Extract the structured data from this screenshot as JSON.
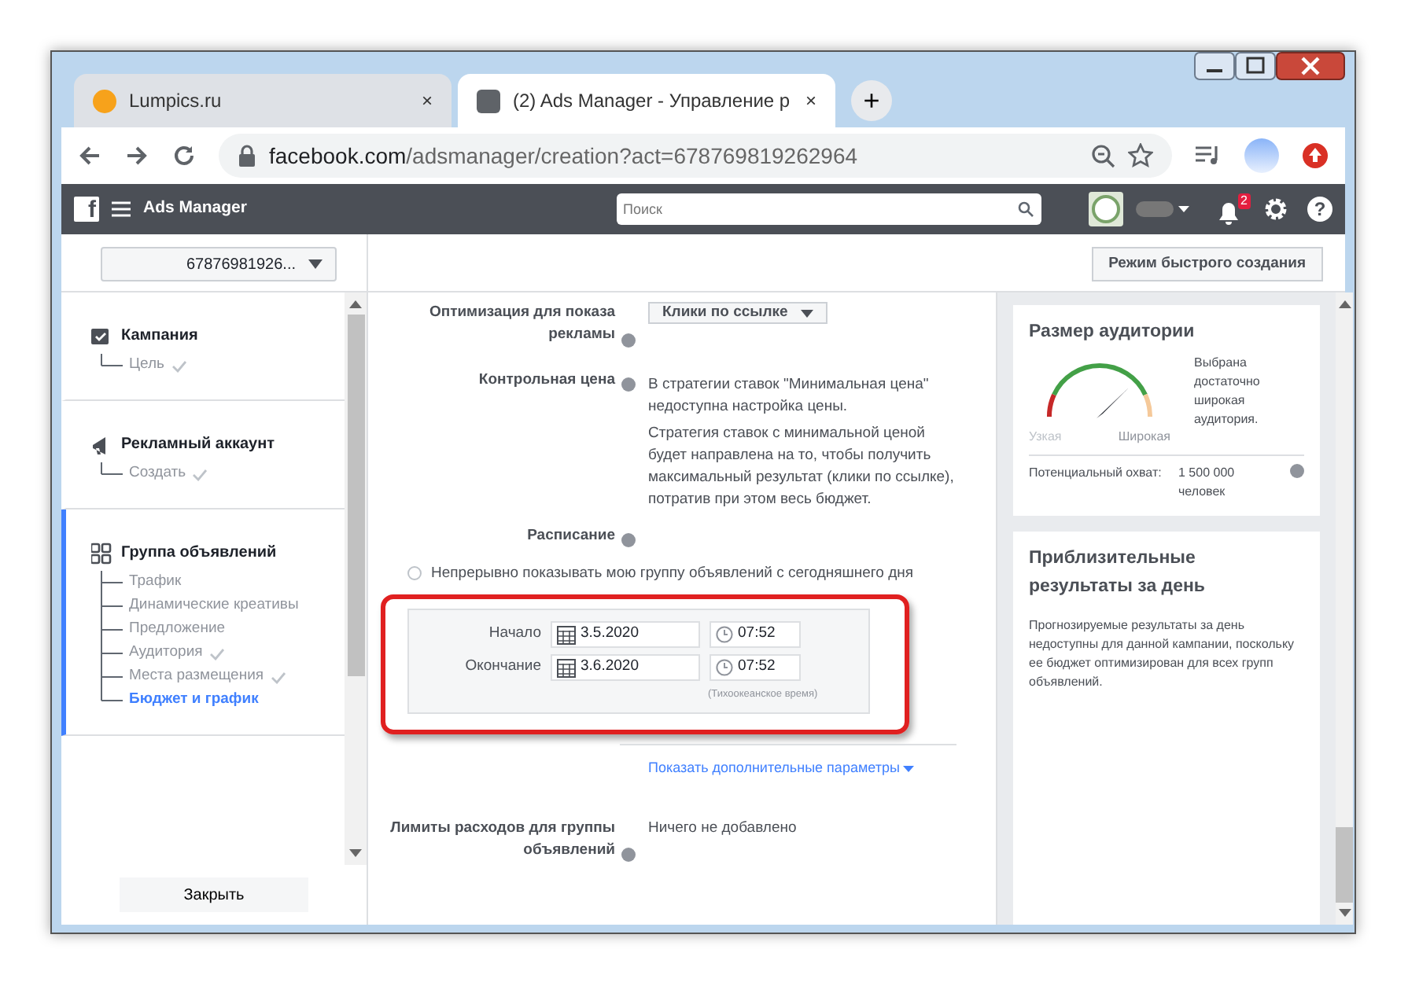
{
  "browser": {
    "tabs": [
      {
        "title": "Lumpics.ru",
        "close": "×",
        "selected": false,
        "color": "#f7a21b"
      },
      {
        "title": "(2) Ads Manager - Управление р",
        "close": "×",
        "selected": true,
        "color": "#5f6368"
      }
    ],
    "new_tab": "+",
    "url_host": "facebook.com",
    "url_path": "/adsmanager/creation?act=678769819262964"
  },
  "header": {
    "logo": "f",
    "title": "Ads Manager",
    "search_placeholder": "Поиск",
    "notifications": "2",
    "help": "?"
  },
  "account_selector": "67876981926...",
  "quick_mode_button": "Режим быстрого создания",
  "sidebar": {
    "sections": [
      {
        "kind": "campaign",
        "title": "Кампания",
        "active": false,
        "children": [
          {
            "label": "Цель",
            "done": true,
            "selected": false
          }
        ]
      },
      {
        "kind": "account",
        "title": "Рекламный аккаунт",
        "active": false,
        "children": [
          {
            "label": "Создать",
            "done": true,
            "selected": false
          }
        ]
      },
      {
        "kind": "adset",
        "title": "Группа объявлений",
        "active": true,
        "children": [
          {
            "label": "Трафик",
            "done": false,
            "selected": false
          },
          {
            "label": "Динамические креативы",
            "done": false,
            "selected": false
          },
          {
            "label": "Предложение",
            "done": false,
            "selected": false
          },
          {
            "label": "Аудитория",
            "done": true,
            "selected": false
          },
          {
            "label": "Места размещения",
            "done": true,
            "selected": false
          },
          {
            "label": "Бюджет и график",
            "done": false,
            "selected": true
          }
        ]
      }
    ],
    "close_button": "Закрыть"
  },
  "form": {
    "optimization_label": "Оптимизация для показа рекламы",
    "optimization_value": "Клики по ссылке",
    "cost_label": "Контрольная цена",
    "cost_text_1": "В стратегии ставок \"Минимальная цена\" недоступна настройка цены.",
    "cost_text_2": "Стратегия ставок с минимальной ценой будет направлена на то, чтобы получить максимальный результат (клики по ссылке), потратив при этом весь бюджет.",
    "schedule_label": "Расписание",
    "schedule_options": [
      {
        "label": "Непрерывно показывать мою группу объявлений с сегодняшнего дня",
        "selected": false
      }
    ],
    "dates": [
      {
        "label": "Начало",
        "date": "3.5.2020",
        "time": "07:52"
      },
      {
        "label": "Окончание",
        "date": "3.6.2020",
        "time": "07:52"
      }
    ],
    "timezone": "(Тихоокеанское время)",
    "more_link": "Показать дополнительные параметры",
    "limits_label": "Лимиты расходов для группы объявлений",
    "limits_value": "Ничего не добавлено"
  },
  "audience": {
    "title": "Размер аудитории",
    "narrow": "Узкая",
    "wide": "Широкая",
    "verdict": "Выбрана достаточно широкая аудитория.",
    "reach_label": "Потенциальный охват:",
    "reach_value": "1 500 000 человек"
  },
  "results": {
    "title": "Приблизительные результаты за день",
    "text": "Прогнозируемые результаты за день недоступны для данной кампании, поскольку ее бюджет оптимизирован для всех групп объявлений."
  }
}
